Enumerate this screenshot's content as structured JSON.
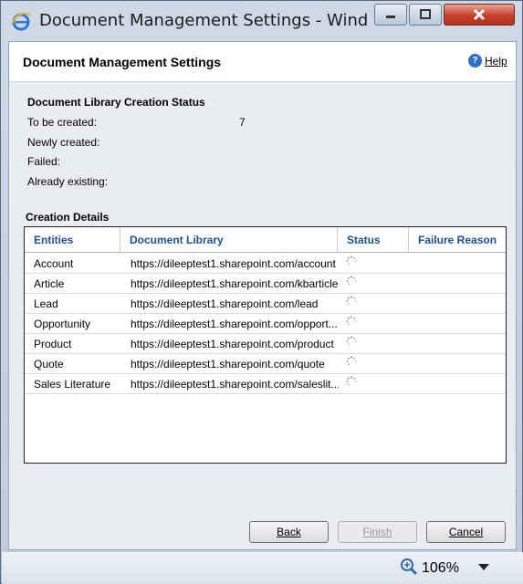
{
  "window": {
    "title": "Document Management Settings - Windows..."
  },
  "header": {
    "title": "Document Management Settings",
    "help_label": "Help"
  },
  "status": {
    "section_title": "Document Library Creation Status",
    "items": [
      {
        "label": "To be created:",
        "value": "7"
      },
      {
        "label": "Newly created:",
        "value": ""
      },
      {
        "label": "Failed:",
        "value": ""
      },
      {
        "label": "Already existing:",
        "value": ""
      }
    ]
  },
  "details": {
    "section_title": "Creation Details",
    "columns": [
      "Entities",
      "Document Library",
      "Status",
      "Failure Reason"
    ],
    "rows": [
      {
        "entity": "Account",
        "library": "https://dileeptest1.sharepoint.com/account"
      },
      {
        "entity": "Article",
        "library": "https://dileeptest1.sharepoint.com/kbarticle"
      },
      {
        "entity": "Lead",
        "library": "https://dileeptest1.sharepoint.com/lead"
      },
      {
        "entity": "Opportunity",
        "library": "https://dileeptest1.sharepoint.com/opport..."
      },
      {
        "entity": "Product",
        "library": "https://dileeptest1.sharepoint.com/product"
      },
      {
        "entity": "Quote",
        "library": "https://dileeptest1.sharepoint.com/quote"
      },
      {
        "entity": "Sales Literature",
        "library": "https://dileeptest1.sharepoint.com/saleslit..."
      }
    ]
  },
  "buttons": {
    "back": "Back",
    "finish": "Finish",
    "cancel": "Cancel"
  },
  "statusbar": {
    "zoom": "106%"
  },
  "colors": {
    "accent": "#1c4f9c",
    "close_button": "#c4402b"
  }
}
